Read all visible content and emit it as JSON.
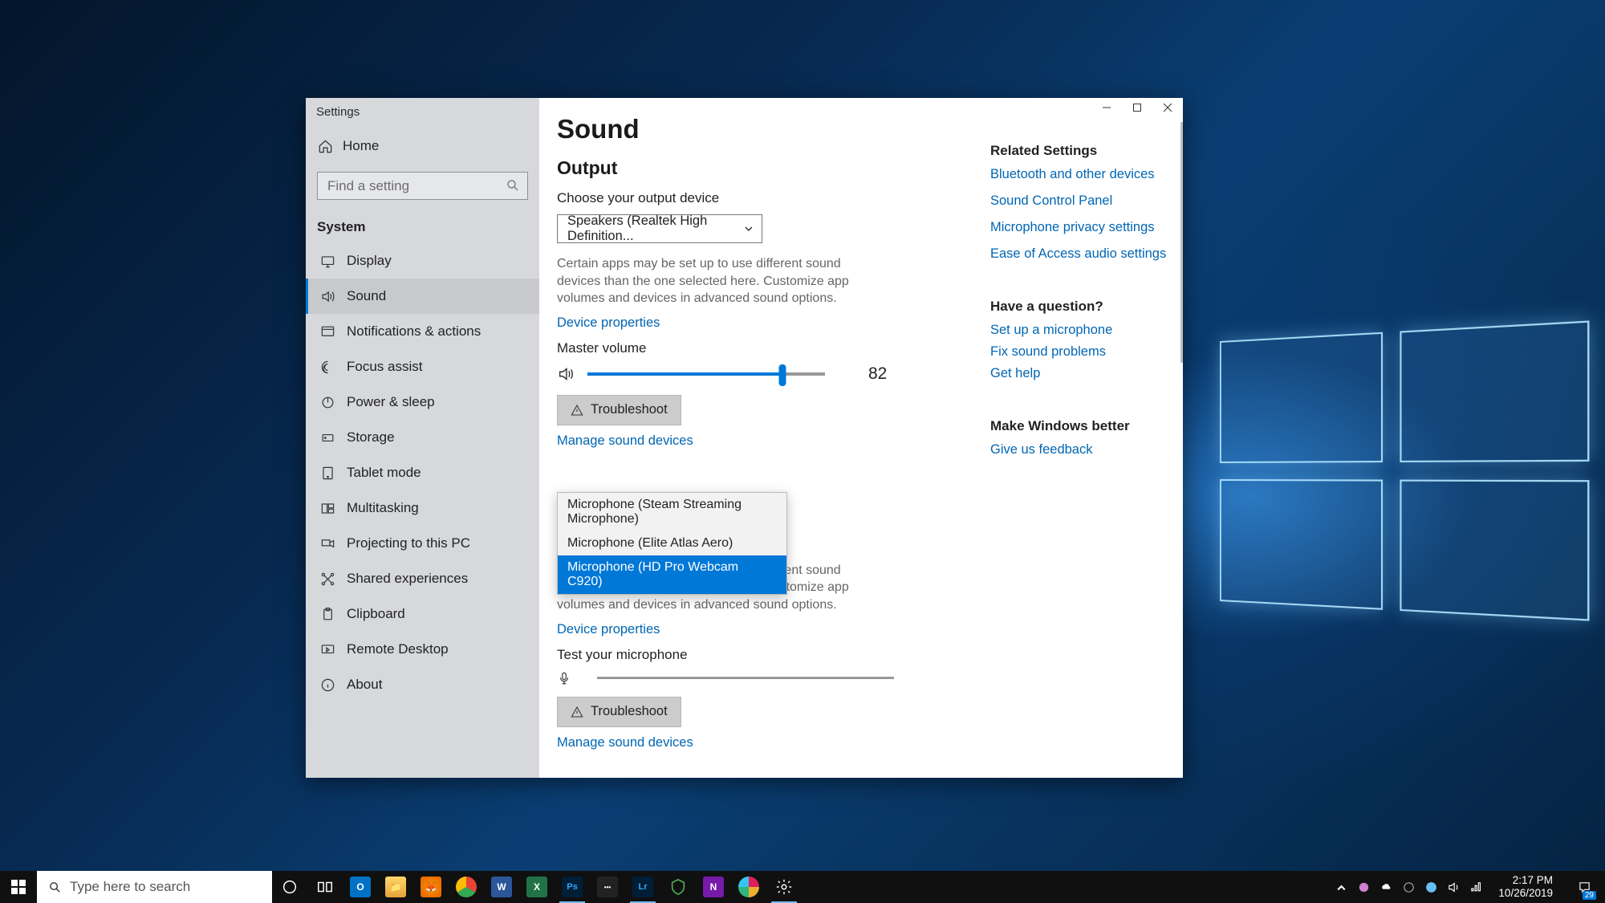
{
  "window": {
    "title": "Settings"
  },
  "sidebar": {
    "home": "Home",
    "search_placeholder": "Find a setting",
    "category": "System",
    "items": [
      {
        "label": "Display"
      },
      {
        "label": "Sound"
      },
      {
        "label": "Notifications & actions"
      },
      {
        "label": "Focus assist"
      },
      {
        "label": "Power & sleep"
      },
      {
        "label": "Storage"
      },
      {
        "label": "Tablet mode"
      },
      {
        "label": "Multitasking"
      },
      {
        "label": "Projecting to this PC"
      },
      {
        "label": "Shared experiences"
      },
      {
        "label": "Clipboard"
      },
      {
        "label": "Remote Desktop"
      },
      {
        "label": "About"
      }
    ],
    "active_index": 1
  },
  "page": {
    "title": "Sound",
    "output": {
      "heading": "Output",
      "choose_label": "Choose your output device",
      "device": "Speakers (Realtek High Definition...",
      "description": "Certain apps may be set up to use different sound devices than the one selected here. Customize app volumes and devices in advanced sound options.",
      "device_properties": "Device properties",
      "master_volume_label": "Master volume",
      "volume": 82,
      "troubleshoot": "Troubleshoot",
      "manage": "Manage sound devices"
    },
    "input": {
      "dropdown_options": [
        "Microphone (Steam Streaming Microphone)",
        "Microphone (Elite Atlas Aero)",
        "Microphone (HD Pro Webcam C920)"
      ],
      "selected_index": 2,
      "description": "Certain apps may be set up to use different sound devices than the one selected here. Customize app volumes and devices in advanced sound options.",
      "device_properties": "Device properties",
      "test_label": "Test your microphone",
      "troubleshoot": "Troubleshoot",
      "manage": "Manage sound devices"
    }
  },
  "related": {
    "heading": "Related Settings",
    "links": [
      "Bluetooth and other devices",
      "Sound Control Panel",
      "Microphone privacy settings",
      "Ease of Access audio settings"
    ],
    "question_heading": "Have a question?",
    "question_links": [
      "Set up a microphone",
      "Fix sound problems",
      "Get help"
    ],
    "feedback_heading": "Make Windows better",
    "feedback_link": "Give us feedback"
  },
  "taskbar": {
    "search_placeholder": "Type here to search",
    "time": "2:17 PM",
    "date": "10/26/2019",
    "notif_count": "29"
  }
}
